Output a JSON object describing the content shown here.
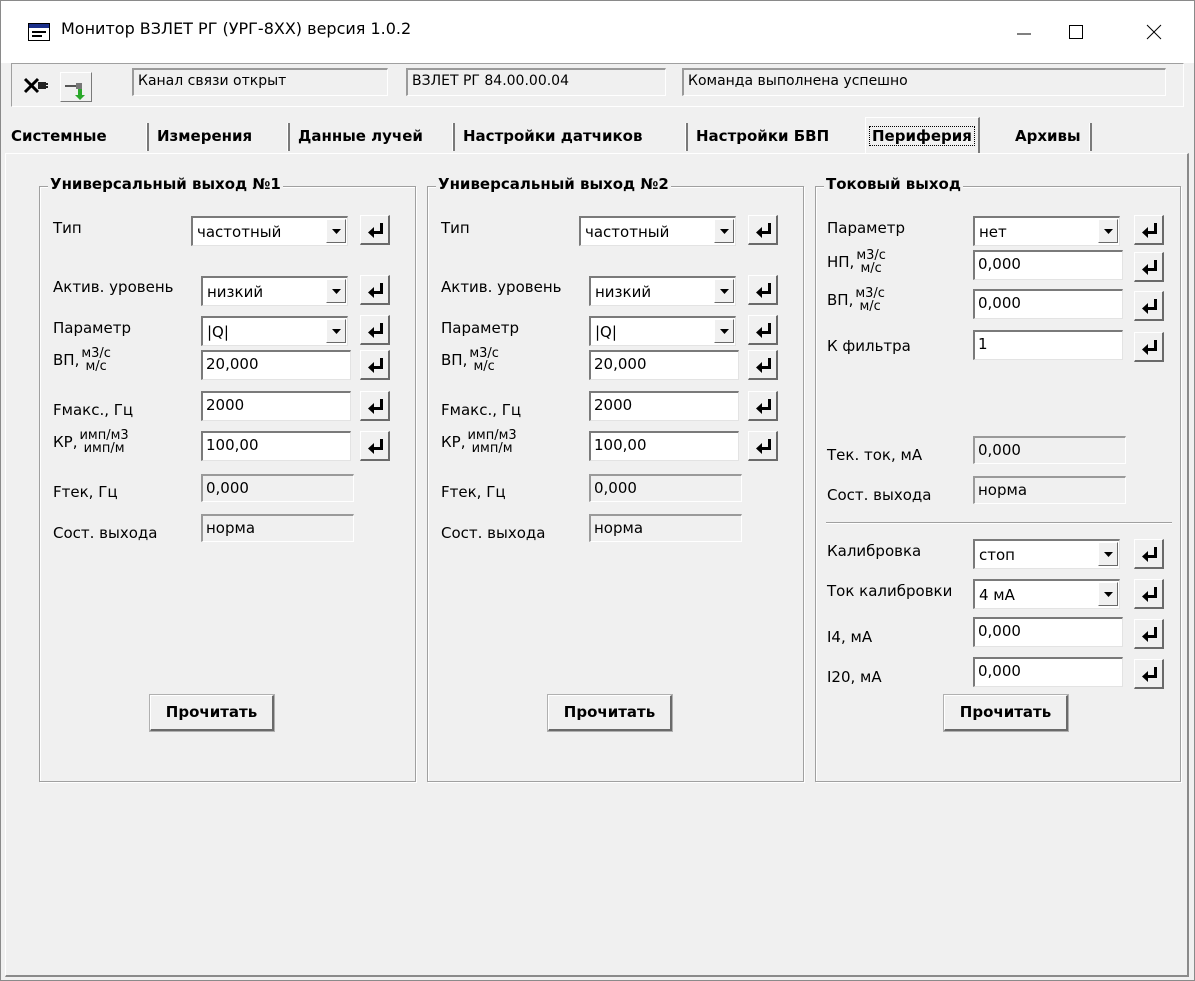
{
  "window": {
    "title": "Монитор ВЗЛЕТ РГ (УРГ-8ХХ) версия 1.0.2"
  },
  "status": {
    "channel": "Канал связи открыт",
    "device": "ВЗЛЕТ РГ 84.00.00.04",
    "command": "Команда выполнена успешно"
  },
  "tabs": [
    {
      "label": "Системные"
    },
    {
      "label": "Измерения"
    },
    {
      "label": "Данные лучей"
    },
    {
      "label": "Настройки датчиков"
    },
    {
      "label": "Настройки БВП"
    },
    {
      "label": "Периферия",
      "active": true
    },
    {
      "label": "Архивы"
    }
  ],
  "out1": {
    "title": "Универсальный выход №1",
    "type_label": "Тип",
    "type_value": "частотный",
    "level_label": "Актив. уровень",
    "level_value": "низкий",
    "param_label": "Параметр",
    "param_value": "|Q|",
    "vp_label": "ВП,",
    "vp_unit_top": "м3/с",
    "vp_unit_bottom": "м/с",
    "vp_value": "20,000",
    "fmax_label": "Fмакс., Гц",
    "fmax_value": "2000",
    "kp_label": "КР,",
    "kp_unit_top": "имп/м3",
    "kp_unit_bottom": "имп/м",
    "kp_value": "100,00",
    "ftek_label": "Fтек, Гц",
    "ftek_value": "0,000",
    "state_label": "Сост. выхода",
    "state_value": "норма",
    "read_button": "Прочитать"
  },
  "out2": {
    "title": "Универсальный выход №2",
    "type_label": "Тип",
    "type_value": "частотный",
    "level_label": "Актив. уровень",
    "level_value": "низкий",
    "param_label": "Параметр",
    "param_value": "|Q|",
    "vp_label": "ВП,",
    "vp_unit_top": "м3/с",
    "vp_unit_bottom": "м/с",
    "vp_value": "20,000",
    "fmax_label": "Fмакс., Гц",
    "fmax_value": "2000",
    "kp_label": "КР,",
    "kp_unit_top": "имп/м3",
    "kp_unit_bottom": "имп/м",
    "kp_value": "100,00",
    "ftek_label": "Fтек, Гц",
    "ftek_value": "0,000",
    "state_label": "Сост. выхода",
    "state_value": "норма",
    "read_button": "Прочитать"
  },
  "current": {
    "title": "Токовый выход",
    "param_label": "Параметр",
    "param_value": "нет",
    "np_label": "НП,",
    "np_unit_top": "м3/с",
    "np_unit_bottom": "м/с",
    "np_value": "0,000",
    "vp_label": "ВП,",
    "vp_unit_top": "м3/с",
    "vp_unit_bottom": "м/с",
    "vp_value": "0,000",
    "kf_label": "К фильтра",
    "kf_value": "1",
    "tok_label": "Тек. ток, мА",
    "tok_value": "0,000",
    "state_label": "Сост. выхода",
    "state_value": "норма",
    "cal_label": "Калибровка",
    "cal_value": "стоп",
    "caltok_label": "Ток калибровки",
    "caltok_value": "4 мА",
    "i4_label": "I4, мА",
    "i4_value": "0,000",
    "i20_label": "I20, мА",
    "i20_value": "0,000",
    "read_button": "Прочитать"
  }
}
